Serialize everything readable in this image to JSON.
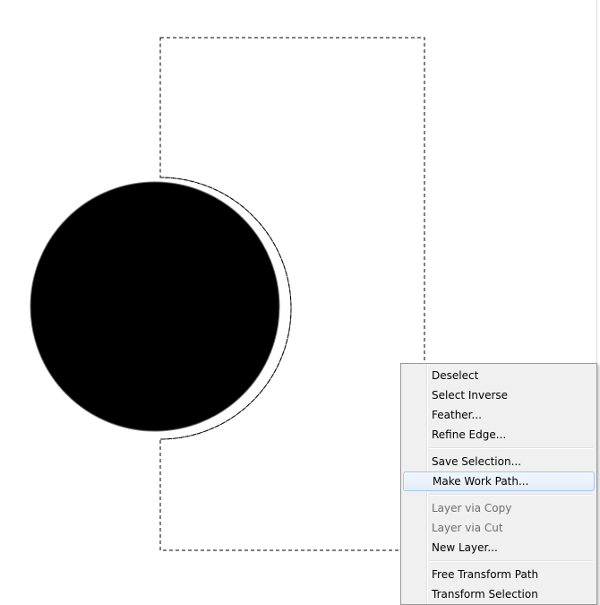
{
  "menu": {
    "groups": [
      [
        {
          "label": "Deselect",
          "enabled": true
        },
        {
          "label": "Select Inverse",
          "enabled": true
        },
        {
          "label": "Feather...",
          "enabled": true
        },
        {
          "label": "Refine Edge...",
          "enabled": true
        }
      ],
      [
        {
          "label": "Save Selection...",
          "enabled": true
        },
        {
          "label": "Make Work Path...",
          "enabled": true,
          "highlighted": true
        }
      ],
      [
        {
          "label": "Layer via Copy",
          "enabled": false
        },
        {
          "label": "Layer via Cut",
          "enabled": false
        },
        {
          "label": "New Layer...",
          "enabled": true
        }
      ],
      [
        {
          "label": "Free Transform Path",
          "enabled": true
        },
        {
          "label": "Transform Selection",
          "enabled": true
        }
      ]
    ]
  },
  "colors": {
    "canvas": "#ffffff",
    "shape": "#000000",
    "menu_bg": "#f0f0f0",
    "menu_highlight_border": "#a8c8ea"
  }
}
